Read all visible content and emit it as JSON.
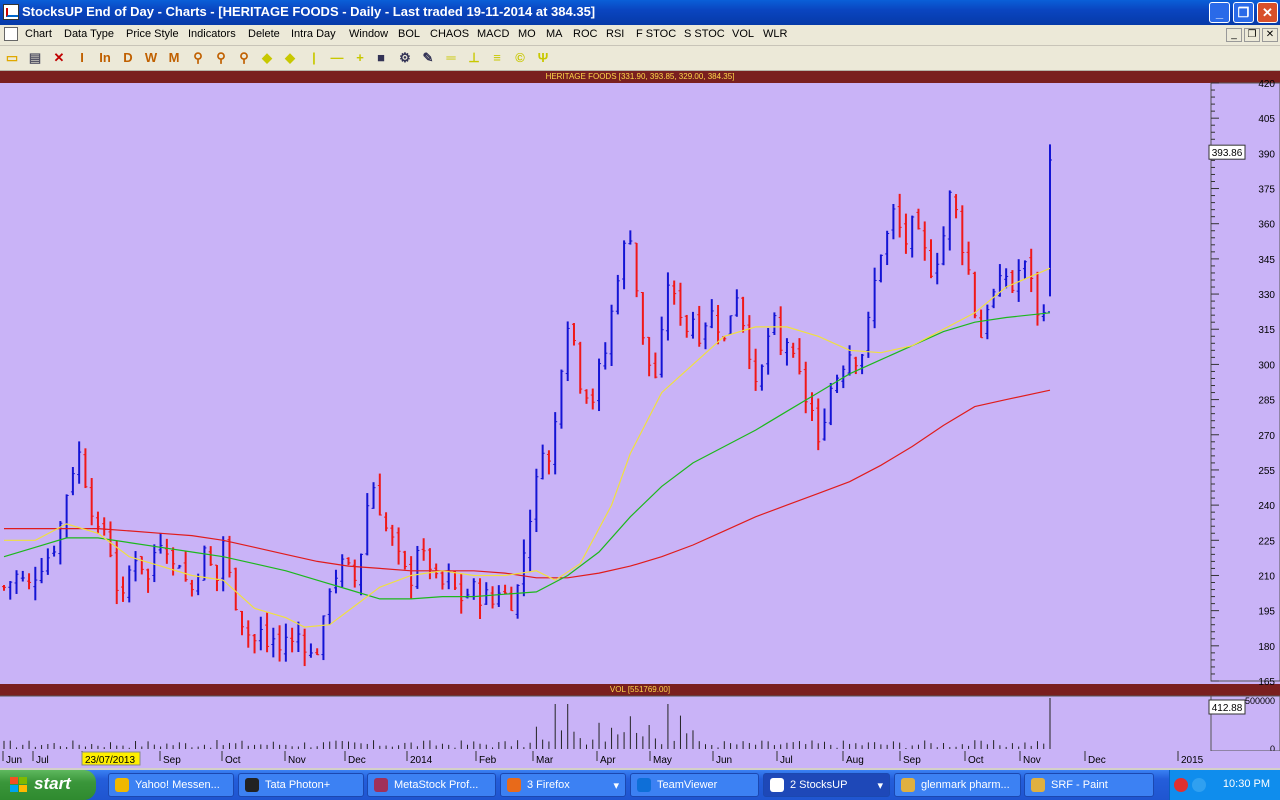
{
  "window": {
    "title": "StocksUP End of Day - Charts - [HERITAGE FOODS - Daily - Last traded 19-11-2014 at 384.35]",
    "controls": [
      "_",
      "❐",
      "✕"
    ]
  },
  "menu": [
    "Chart",
    "Data Type",
    "Price Style",
    "Indicators",
    "Delete",
    "Intra Day",
    "Window",
    "BOL",
    "CHAOS",
    "MACD",
    "MO",
    "MA",
    "ROC",
    "RSI",
    "F STOC",
    "S STOC",
    "VOL",
    "WLR"
  ],
  "mdi_controls": [
    "_",
    "❐",
    "✕"
  ],
  "toolbar": {
    "icons": [
      {
        "name": "open-folder-icon",
        "glyph": "▭",
        "color": "#e0a800"
      },
      {
        "name": "new-document-icon",
        "glyph": "▤",
        "color": "#556"
      },
      {
        "name": "delete-icon",
        "glyph": "✕",
        "color": "#c00000"
      },
      {
        "name": "indicator-i-icon",
        "glyph": "I",
        "color": "#c06000"
      },
      {
        "name": "indicator-in-icon",
        "glyph": "In",
        "color": "#c06000"
      },
      {
        "name": "daily-icon",
        "glyph": "D",
        "color": "#c06000"
      },
      {
        "name": "weekly-icon",
        "glyph": "W",
        "color": "#c06000"
      },
      {
        "name": "monthly-icon",
        "glyph": "M",
        "color": "#c06000"
      },
      {
        "name": "zoom-in-icon",
        "glyph": "⚲",
        "color": "#c06000"
      },
      {
        "name": "zoom-out-icon",
        "glyph": "⚲",
        "color": "#c06000"
      },
      {
        "name": "zoom-box-icon",
        "glyph": "⚲",
        "color": "#c06000"
      },
      {
        "name": "scroll-left-icon",
        "glyph": "◆",
        "color": "#c8c800"
      },
      {
        "name": "scroll-right-icon",
        "glyph": "◆",
        "color": "#c8c800"
      },
      {
        "name": "vertical-line-icon",
        "glyph": "|",
        "color": "#c8c800"
      },
      {
        "name": "horizontal-line-icon",
        "glyph": "—",
        "color": "#c8c800"
      },
      {
        "name": "crosshair-icon",
        "glyph": "+",
        "color": "#c8c800"
      },
      {
        "name": "screen-icon",
        "glyph": "■",
        "color": "#335"
      },
      {
        "name": "settings-wheel-icon",
        "glyph": "⚙",
        "color": "#335"
      },
      {
        "name": "pencil-icon",
        "glyph": "✎",
        "color": "#335"
      },
      {
        "name": "parallel-lines-icon",
        "glyph": "═",
        "color": "#c8c800"
      },
      {
        "name": "support-line-icon",
        "glyph": "⊥",
        "color": "#c8c800"
      },
      {
        "name": "fibonacci-icon",
        "glyph": "≡",
        "color": "#c8c800"
      },
      {
        "name": "cycle-icon",
        "glyph": "©",
        "color": "#c8c800"
      },
      {
        "name": "fork-icon",
        "glyph": "Ψ",
        "color": "#c8c800"
      }
    ]
  },
  "chart_header": "HERITAGE FOODS [331.90, 393.85, 329.00, 384.35]",
  "volume_header": "VOL [551769.00]",
  "last_price_marker": "393.86",
  "last_volume_marker": "412.88",
  "chart_data": [
    {
      "type": "bar",
      "title": "HERITAGE FOODS [331.90, 393.85, 329.00, 384.35]",
      "y_axis_ticks": [
        420,
        405,
        390,
        375,
        360,
        345,
        330,
        315,
        300,
        285,
        270,
        255,
        240,
        225,
        210,
        195,
        180,
        165
      ],
      "ylim": [
        165,
        420
      ],
      "x_axis_labels": [
        "Jun",
        "Jul",
        "23/07/2013",
        "Sep",
        "Oct",
        "Nov",
        "Dec",
        "2014",
        "Feb",
        "Mar",
        "Apr",
        "May",
        "Jun",
        "Jul",
        "Aug",
        "Sep",
        "Oct",
        "Nov",
        "Dec",
        "2015"
      ],
      "colors": {
        "up": "#1414d4",
        "down": "#f01818",
        "ma_short": "#f0e040",
        "ma_mid": "#1cb81c",
        "ma_long": "#e01c1c"
      },
      "close_path": [
        [
          0,
          205
        ],
        [
          2,
          210
        ],
        [
          4,
          206
        ],
        [
          6,
          214
        ],
        [
          8,
          222
        ],
        [
          9,
          232
        ],
        [
          10,
          245
        ],
        [
          11,
          255
        ],
        [
          12,
          262
        ],
        [
          13,
          250
        ],
        [
          14,
          238
        ],
        [
          15,
          228
        ],
        [
          16,
          230
        ],
        [
          17,
          220
        ],
        [
          18,
          205
        ],
        [
          19,
          200
        ],
        [
          20,
          212
        ],
        [
          21,
          218
        ],
        [
          22,
          214
        ],
        [
          23,
          208
        ],
        [
          24,
          220
        ],
        [
          25,
          225
        ],
        [
          26,
          222
        ],
        [
          27,
          214
        ],
        [
          28,
          216
        ],
        [
          29,
          208
        ],
        [
          30,
          204
        ],
        [
          31,
          212
        ],
        [
          32,
          220
        ],
        [
          33,
          214
        ],
        [
          34,
          208
        ],
        [
          35,
          225
        ],
        [
          36,
          210
        ],
        [
          37,
          198
        ],
        [
          38,
          190
        ],
        [
          39,
          185
        ],
        [
          40,
          182
        ],
        [
          41,
          186
        ],
        [
          42,
          180
        ],
        [
          43,
          183
        ],
        [
          44,
          178
        ],
        [
          45,
          184
        ],
        [
          46,
          181
        ],
        [
          47,
          185
        ],
        [
          48,
          180
        ],
        [
          49,
          176
        ],
        [
          50,
          178
        ],
        [
          51,
          190
        ],
        [
          52,
          205
        ],
        [
          53,
          210
        ],
        [
          54,
          215
        ],
        [
          55,
          213
        ],
        [
          56,
          208
        ],
        [
          57,
          220
        ],
        [
          58,
          240
        ],
        [
          59,
          248
        ],
        [
          60,
          238
        ],
        [
          61,
          230
        ],
        [
          62,
          225
        ],
        [
          63,
          218
        ],
        [
          64,
          212
        ],
        [
          65,
          208
        ],
        [
          66,
          222
        ],
        [
          67,
          218
        ],
        [
          68,
          214
        ],
        [
          69,
          208
        ],
        [
          70,
          206
        ],
        [
          71,
          210
        ],
        [
          72,
          204
        ],
        [
          73,
          200
        ],
        [
          74,
          202
        ],
        [
          75,
          205
        ],
        [
          76,
          200
        ],
        [
          77,
          202
        ],
        [
          78,
          198
        ],
        [
          79,
          204
        ],
        [
          80,
          202
        ],
        [
          81,
          198
        ],
        [
          82,
          205
        ],
        [
          83,
          220
        ],
        [
          84,
          235
        ],
        [
          85,
          250
        ],
        [
          86,
          265
        ],
        [
          87,
          258
        ],
        [
          88,
          275
        ],
        [
          89,
          300
        ],
        [
          90,
          318
        ],
        [
          91,
          310
        ],
        [
          92,
          292
        ],
        [
          93,
          288
        ],
        [
          94,
          285
        ],
        [
          95,
          298
        ],
        [
          96,
          305
        ],
        [
          97,
          322
        ],
        [
          98,
          338
        ],
        [
          99,
          350
        ],
        [
          100,
          355
        ],
        [
          101,
          332
        ],
        [
          102,
          310
        ],
        [
          103,
          300
        ],
        [
          104,
          295
        ],
        [
          105,
          312
        ],
        [
          106,
          335
        ],
        [
          107,
          328
        ],
        [
          108,
          322
        ],
        [
          109,
          315
        ],
        [
          110,
          320
        ],
        [
          111,
          312
        ],
        [
          112,
          318
        ],
        [
          113,
          322
        ],
        [
          114,
          316
        ],
        [
          115,
          310
        ],
        [
          116,
          322
        ],
        [
          117,
          330
        ],
        [
          118,
          318
        ],
        [
          119,
          305
        ],
        [
          120,
          290
        ],
        [
          121,
          298
        ],
        [
          122,
          312
        ],
        [
          123,
          318
        ],
        [
          124,
          305
        ],
        [
          125,
          310
        ],
        [
          126,
          302
        ],
        [
          127,
          295
        ],
        [
          128,
          285
        ],
        [
          129,
          280
        ],
        [
          130,
          265
        ],
        [
          131,
          278
        ],
        [
          132,
          290
        ],
        [
          133,
          295
        ],
        [
          134,
          300
        ],
        [
          135,
          305
        ],
        [
          136,
          302
        ],
        [
          137,
          305
        ],
        [
          138,
          318
        ],
        [
          139,
          335
        ],
        [
          140,
          348
        ],
        [
          141,
          355
        ],
        [
          142,
          365
        ],
        [
          143,
          358
        ],
        [
          144,
          352
        ],
        [
          145,
          360
        ],
        [
          146,
          355
        ],
        [
          147,
          348
        ],
        [
          148,
          340
        ],
        [
          149,
          345
        ],
        [
          150,
          355
        ],
        [
          151,
          372
        ],
        [
          152,
          365
        ],
        [
          153,
          350
        ],
        [
          154,
          340
        ],
        [
          155,
          322
        ],
        [
          156,
          312
        ],
        [
          157,
          325
        ],
        [
          158,
          330
        ],
        [
          159,
          335
        ],
        [
          160,
          338
        ],
        [
          161,
          332
        ],
        [
          162,
          340
        ],
        [
          163,
          342
        ],
        [
          164,
          338
        ],
        [
          165,
          320
        ],
        [
          166,
          325
        ],
        [
          167,
          385
        ]
      ],
      "moving_averages": {
        "short": [
          [
            0,
            225
          ],
          [
            5,
            225
          ],
          [
            10,
            232
          ],
          [
            15,
            228
          ],
          [
            20,
            218
          ],
          [
            25,
            214
          ],
          [
            30,
            210
          ],
          [
            35,
            208
          ],
          [
            40,
            196
          ],
          [
            45,
            192
          ],
          [
            48,
            188
          ],
          [
            52,
            189
          ],
          [
            55,
            195
          ],
          [
            60,
            205
          ],
          [
            65,
            210
          ],
          [
            70,
            212
          ],
          [
            75,
            210
          ],
          [
            80,
            210
          ],
          [
            85,
            212
          ],
          [
            88,
            208
          ],
          [
            92,
            215
          ],
          [
            97,
            240
          ],
          [
            100,
            262
          ],
          [
            105,
            288
          ],
          [
            110,
            300
          ],
          [
            115,
            312
          ],
          [
            120,
            316
          ],
          [
            125,
            316
          ],
          [
            130,
            312
          ],
          [
            135,
            306
          ],
          [
            140,
            305
          ],
          [
            145,
            308
          ],
          [
            150,
            315
          ],
          [
            155,
            322
          ],
          [
            160,
            333
          ],
          [
            167,
            341
          ]
        ],
        "mid": [
          [
            0,
            218
          ],
          [
            5,
            222
          ],
          [
            10,
            226
          ],
          [
            15,
            226
          ],
          [
            20,
            224
          ],
          [
            25,
            222
          ],
          [
            30,
            220
          ],
          [
            35,
            218
          ],
          [
            40,
            215
          ],
          [
            45,
            212
          ],
          [
            50,
            208
          ],
          [
            55,
            204
          ],
          [
            60,
            200
          ],
          [
            65,
            200
          ],
          [
            70,
            201
          ],
          [
            75,
            201
          ],
          [
            80,
            202
          ],
          [
            85,
            203
          ],
          [
            90,
            210
          ],
          [
            95,
            220
          ],
          [
            100,
            235
          ],
          [
            105,
            248
          ],
          [
            110,
            258
          ],
          [
            115,
            265
          ],
          [
            120,
            272
          ],
          [
            125,
            280
          ],
          [
            130,
            288
          ],
          [
            135,
            296
          ],
          [
            140,
            302
          ],
          [
            145,
            308
          ],
          [
            150,
            314
          ],
          [
            155,
            318
          ],
          [
            160,
            320
          ],
          [
            167,
            322
          ]
        ],
        "long": [
          [
            0,
            230
          ],
          [
            5,
            230
          ],
          [
            10,
            230
          ],
          [
            15,
            230
          ],
          [
            20,
            229
          ],
          [
            25,
            228
          ],
          [
            30,
            227
          ],
          [
            35,
            225
          ],
          [
            40,
            222
          ],
          [
            45,
            219
          ],
          [
            50,
            216
          ],
          [
            55,
            214
          ],
          [
            60,
            213
          ],
          [
            65,
            212
          ],
          [
            70,
            212
          ],
          [
            75,
            212
          ],
          [
            80,
            211
          ],
          [
            85,
            209
          ],
          [
            90,
            209
          ],
          [
            95,
            211
          ],
          [
            100,
            214
          ],
          [
            105,
            218
          ],
          [
            110,
            223
          ],
          [
            115,
            229
          ],
          [
            120,
            235
          ],
          [
            125,
            240
          ],
          [
            130,
            245
          ],
          [
            135,
            250
          ],
          [
            140,
            257
          ],
          [
            145,
            265
          ],
          [
            150,
            274
          ],
          [
            155,
            282
          ],
          [
            160,
            285
          ],
          [
            167,
            289
          ]
        ]
      }
    },
    {
      "type": "bar",
      "title": "VOL [551769.00]",
      "y_axis_ticks": [
        500000,
        0
      ],
      "note": "daily volume bars; last bar spikes to top"
    }
  ],
  "taskbar": {
    "start_label": "start",
    "tasks": [
      {
        "label": "Yahoo! Messen...",
        "icon_color": "#f0b800"
      },
      {
        "label": "Tata Photon+",
        "icon_color": "#222"
      },
      {
        "label": "MetaStock Prof...",
        "icon_color": "#a0305a"
      },
      {
        "label": "3 Firefox",
        "icon_color": "#e86a1a",
        "arrow": "▾"
      },
      {
        "label": "TeamViewer",
        "icon_color": "#0e6fd8"
      },
      {
        "label": "2 StocksUP",
        "icon_color": "#fff",
        "arrow": "▾",
        "active": true
      },
      {
        "label": "glenmark pharm...",
        "icon_color": "#e0b040"
      },
      {
        "label": "SRF - Paint",
        "icon_color": "#e0b040"
      }
    ],
    "clock": "10:30 PM"
  }
}
